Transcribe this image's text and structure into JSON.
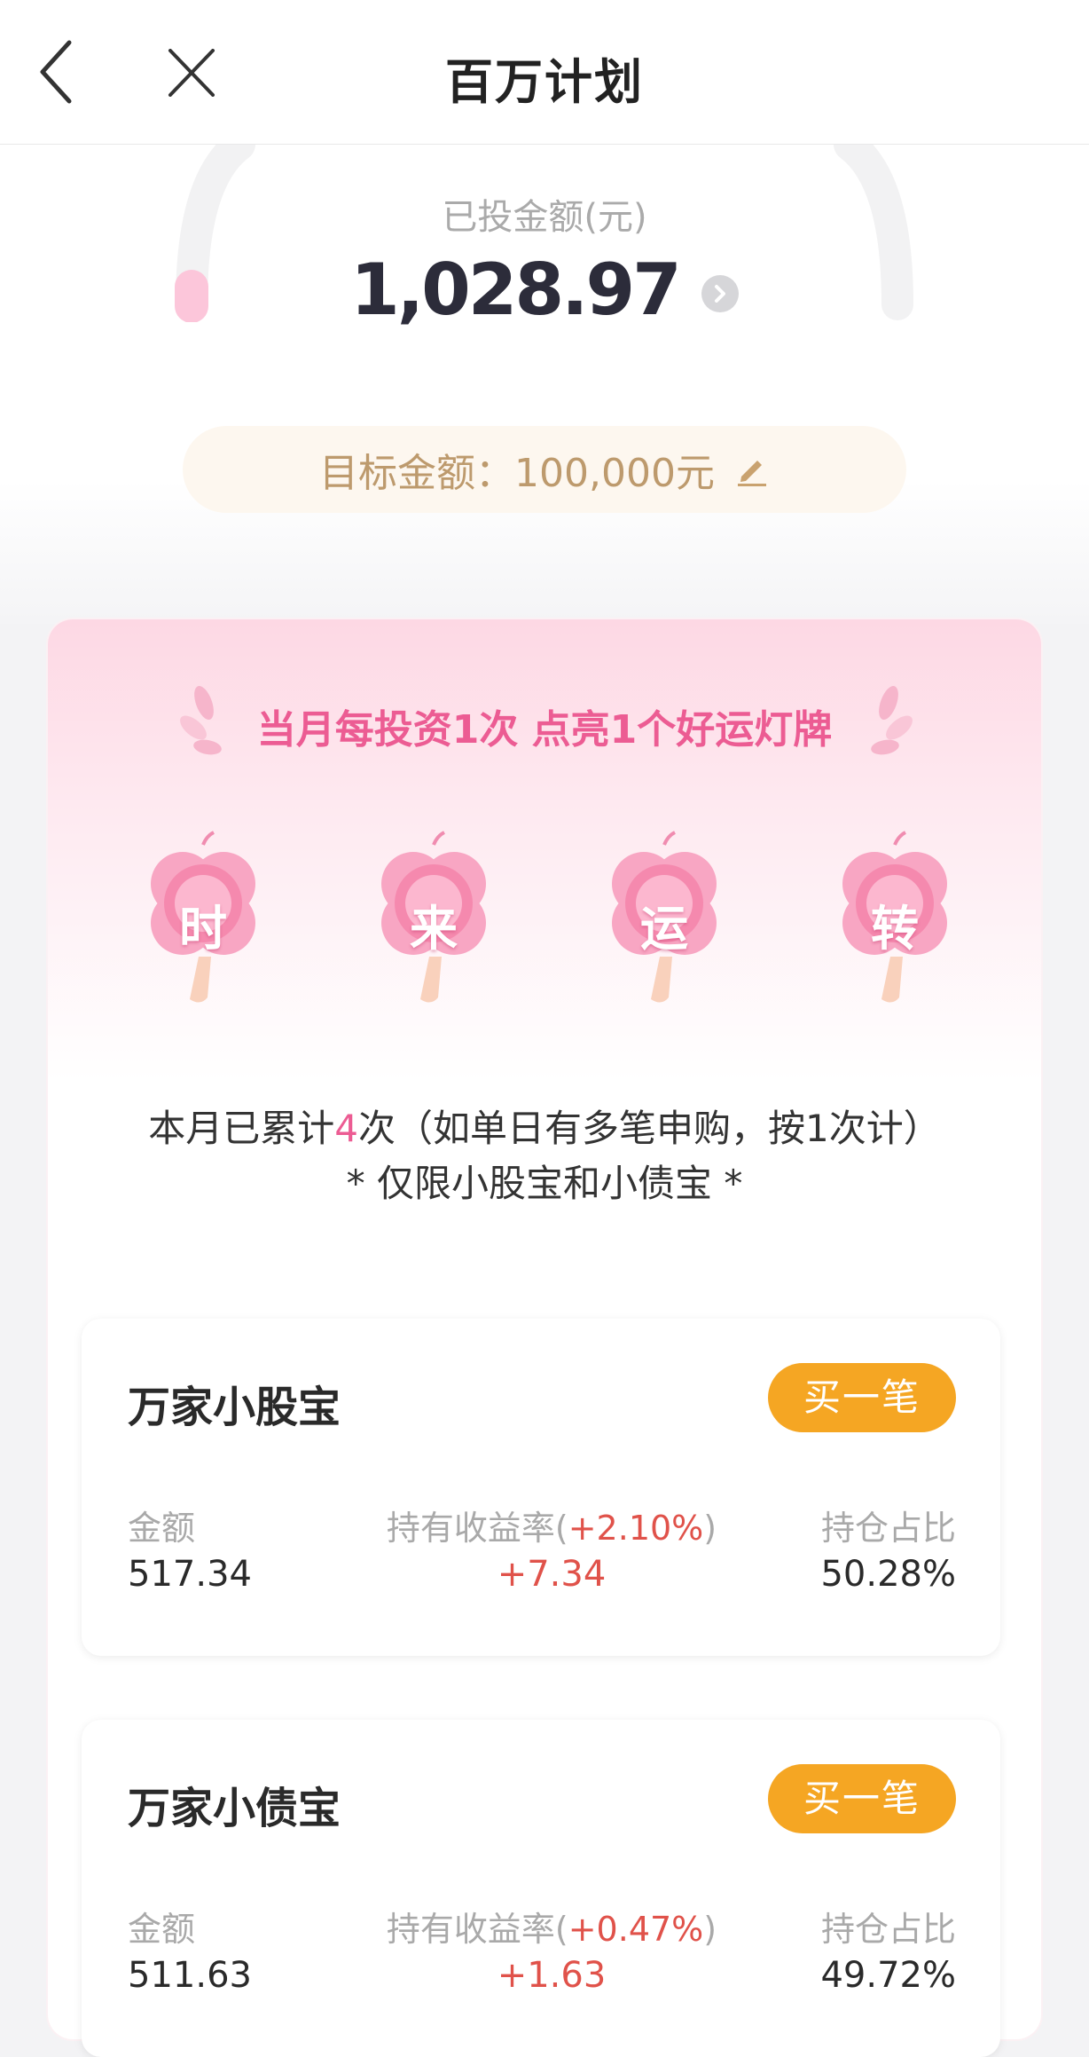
{
  "header": {
    "title": "百万计划"
  },
  "summary": {
    "invested_label": "已投金额(元)",
    "invested_value": "1,028.97",
    "target_text": "目标金额：100,000元"
  },
  "lucky": {
    "headline": "当月每投资1次 点亮1个好运灯牌",
    "lanterns": [
      "时",
      "来",
      "运",
      "转"
    ],
    "count_prefix": "本月已累计",
    "count_value": "4",
    "count_suffix": "次（如单日有多笔申购，按1次计）",
    "limit_note": "* 仅限小股宝和小债宝 *"
  },
  "funds": [
    {
      "name": "万家小股宝",
      "buy_label": "买一笔",
      "amount_label": "金额",
      "amount": "517.34",
      "return_label": "持有收益率",
      "return_rate": "+2.10%",
      "return_value": "+7.34",
      "ratio_label": "持仓占比",
      "ratio": "50.28%"
    },
    {
      "name": "万家小债宝",
      "buy_label": "买一笔",
      "amount_label": "金额",
      "amount": "511.63",
      "return_label": "持有收益率",
      "return_rate": "+0.47%",
      "return_value": "+1.63",
      "ratio_label": "持仓占比",
      "ratio": "49.72%"
    }
  ],
  "icons": [
    "back-arrow-icon",
    "close-icon",
    "chevron-right-icon",
    "edit-pencil-icon",
    "laurel-leaf-icon",
    "lantern-icon"
  ],
  "colors": {
    "accent_pink": "#ec5c93",
    "buy_orange": "#f5a623",
    "gain_red": "#e0524a",
    "target_gold": "#bd9a6d"
  }
}
